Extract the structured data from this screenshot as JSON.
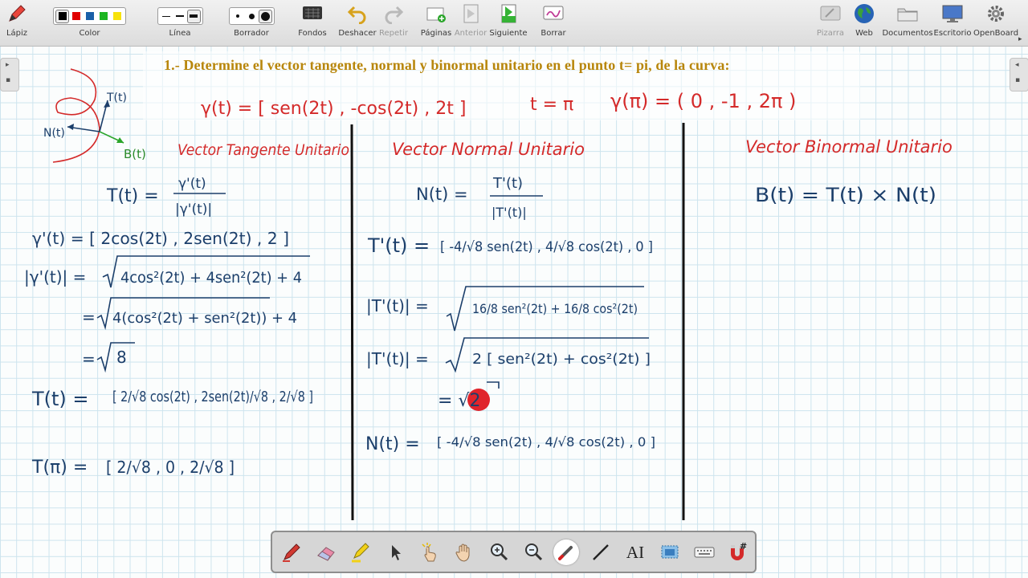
{
  "toolbar": {
    "pencil": "Lápiz",
    "color": "Color",
    "line": "Línea",
    "eraser": "Borrador",
    "backgrounds": "Fondos",
    "undo": "Deshacer",
    "redo": "Repetir",
    "pages": "Páginas",
    "previous": "Anterior",
    "next": "Siguiente",
    "clear": "Borrar",
    "board": "Pizarra",
    "web": "Web",
    "documents": "Documentos",
    "desktop": "Escritorio",
    "openboard": "OpenBoard"
  },
  "colors": [
    "#000000",
    "#e00000",
    "#1a5fa8",
    "#1db521",
    "#f7e20c"
  ],
  "problem": {
    "statement": "1.- Determine el vector tangente, normal y binormal unitario  en el punto t= pi,  de la curva:"
  },
  "handwriting": {
    "curve": "γ(t) = [ sen(2t) ,  -cos(2t) ,  2t ]",
    "t_value": "t = π",
    "gamma_pi": "γ(π) = ( 0 , -1 , 2π )",
    "fig_T": "T(t)",
    "fig_N": "N(t)",
    "fig_B": "B(t)",
    "col1_title": "Vector Tangente Unitario",
    "col1_def_lhs": "T(t) =",
    "col1_def_num": "γ'(t)",
    "col1_def_den": "|γ'(t)|",
    "col1_deriv": "γ'(t)  =  [ 2cos(2t) , 2sen(2t) , 2 ]",
    "col1_norm1_lhs": "|γ'(t)|  =",
    "col1_norm1_rad": "4cos²(2t) + 4sen²(2t) + 4",
    "col1_norm2_rad": "4(cos²(2t) + sen²(2t)) + 4",
    "col1_norm3_rad": "8",
    "col1_T_lhs": "T(t)  =",
    "col1_T_vec": "[ 2/√8 cos(2t) , 2sen(2t)/√8 , 2/√8 ]",
    "col1_Tpi_lhs": "T(π) =",
    "col1_Tpi_vec": "[ 2/√8 , 0 , 2/√8 ]",
    "col2_title": "Vector Normal Unitario",
    "col2_def_lhs": "N(t)  =",
    "col2_def_num": "T'(t)",
    "col2_def_den": "|T'(t)|",
    "col2_Tp_lhs": "T'(t)  =",
    "col2_Tp_vec": "[ -4/√8 sen(2t) , 4/√8 cos(2t) , 0 ]",
    "col2_norm1_lhs": "|T'(t)|  =",
    "col2_norm1_rad": "16/8 sen²(2t) + 16/8 cos²(2t)",
    "col2_norm2_lhs": "|T'(t)|  =",
    "col2_norm2_rad": "2 [ sen²(2t) + cos²(2t) ]",
    "col2_norm3": "= √2",
    "col2_N_lhs": "N(t)  =",
    "col2_N_vec": "[ -4/√8 sen(2t) , 4/√8 cos(2t) , 0 ]",
    "col3_title": "Vector Binormal Unitario",
    "col3_def": "B(t) = T(t) × N(t)"
  },
  "dock": {
    "tools": [
      "pen-icon",
      "eraser-icon",
      "marker-icon",
      "selector-icon",
      "play-icon",
      "hand-icon",
      "zoom-in-icon",
      "zoom-out-icon",
      "laser-pointer-icon",
      "line-icon",
      "text-icon",
      "capture-icon",
      "keyboard-icon",
      "magnet-icon"
    ],
    "text_tool": "AI"
  },
  "ink_colors": {
    "dark": "#1c3f6b",
    "red": "#d42a2a",
    "accent": "#b8860b"
  }
}
